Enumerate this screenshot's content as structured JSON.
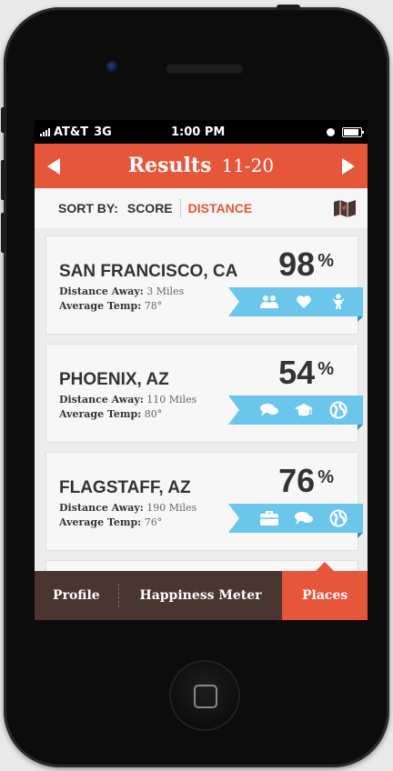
{
  "status_bar": {
    "carrier": "AT&T",
    "network": "3G",
    "time": "1:00 PM"
  },
  "header": {
    "title": "Results",
    "range": "11-20"
  },
  "sort": {
    "label": "SORT BY:",
    "options": [
      "SCORE",
      "DISTANCE"
    ],
    "active": "DISTANCE"
  },
  "results": [
    {
      "city": "SAN FRANCISCO, CA",
      "distance_label": "Distance Away:",
      "distance": "3 Miles",
      "temp_label": "Average Temp:",
      "temp": "78°",
      "score": "98",
      "score_unit": "%",
      "icons": [
        "group-icon",
        "heart-icon",
        "baby-icon"
      ]
    },
    {
      "city": "PHOENIX, AZ",
      "distance_label": "Distance Away:",
      "distance": "110 Miles",
      "temp_label": "Average Temp:",
      "temp": "80°",
      "score": "54",
      "score_unit": "%",
      "icons": [
        "chat-icon",
        "graduation-cap-icon",
        "globe-icon"
      ]
    },
    {
      "city": "FLAGSTAFF, AZ",
      "distance_label": "Distance Away:",
      "distance": "190 Miles",
      "temp_label": "Average Temp:",
      "temp": "76°",
      "score": "76",
      "score_unit": "%",
      "icons": [
        "briefcase-icon",
        "chat-icon",
        "globe-icon"
      ]
    }
  ],
  "tabs": [
    {
      "label": "Profile"
    },
    {
      "label": "Happiness Meter"
    },
    {
      "label": "Places",
      "active": true
    }
  ],
  "colors": {
    "accent": "#e6563b",
    "ribbon": "#6cc6ec",
    "tabbar": "#4b3531"
  }
}
